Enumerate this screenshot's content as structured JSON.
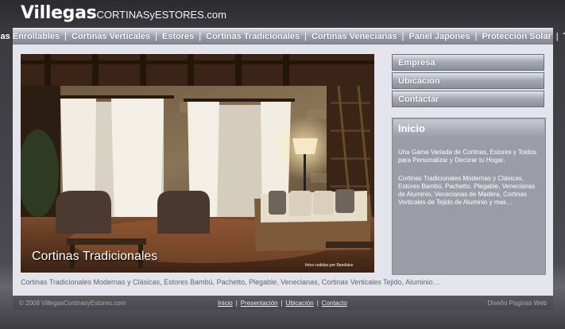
{
  "header": {
    "brand": "Villegas",
    "brand_suffix": "CORTINASyESTORES.com"
  },
  "nav": {
    "items": [
      "Cortinas Enrollables",
      "Cortinas Verticales",
      "Estores",
      "Cortinas Tradicionales",
      "Cortinas Venecianas",
      "Panel Japones",
      "Protección Solar",
      "Toldos"
    ],
    "separator": "|"
  },
  "photo": {
    "caption": "Cortinas Tradicionales",
    "credit": "fotos cedidas por Bandalux"
  },
  "subtitle": "Cortinas Tradicionales Modernas y Clásicas, Estores Bambú, Pachetto, Plegable, Venecianas, Cortinas Verticales Tejido, Aluminio…",
  "side_menu": {
    "items": [
      "Empresa",
      "Ubicación",
      "Contactar"
    ]
  },
  "info": {
    "title": "Inicio",
    "paragraphs": [
      "Una Gama Variada de Cortinas, Estores y Toldos para Personalizar y Decorar tu Hogar,",
      "Cortinas Tradicionales Modernas y Clásicas, Estores Bambú, Pachetto, Plegable, Venecianas de Aluminio, Venecianas de Madera, Cortinas Verticales de Tejido de Aluminio y mas…"
    ]
  },
  "footer": {
    "copyright": "© 2008 VillegasCortinasyEstores.com",
    "links": [
      "Inicio",
      "Presentación",
      "Ubicación",
      "Contacto"
    ],
    "designer": "Diseño Paginas Web"
  }
}
